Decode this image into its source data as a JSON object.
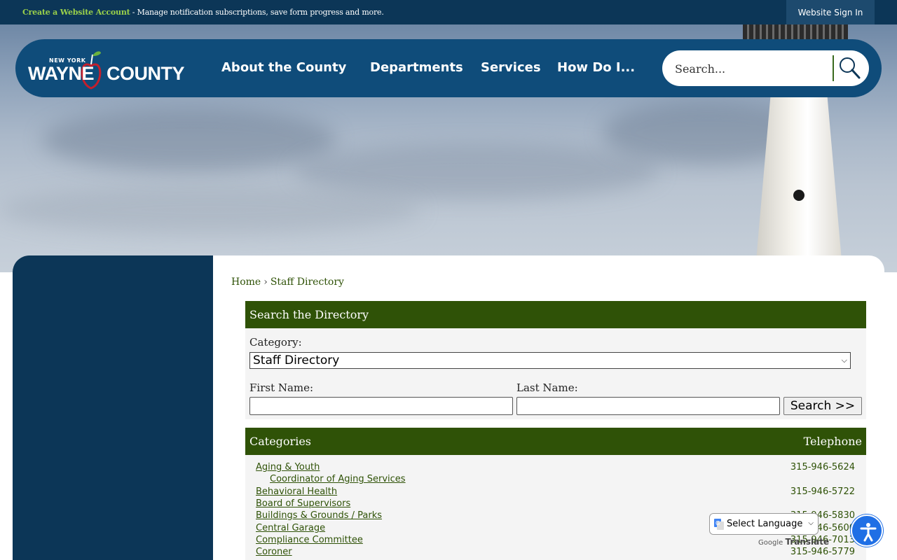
{
  "topbar": {
    "create_account": "Create a Website Account",
    "account_desc": " - Manage notification subscriptions, save form progress and more.",
    "sign_in": "Website Sign In"
  },
  "logo": {
    "state": "NEW YORK",
    "wayne": "WAYNE",
    "county": "COUNTY"
  },
  "nav": {
    "items": [
      {
        "label": "About the County"
      },
      {
        "label": "Departments"
      },
      {
        "label": "Services"
      },
      {
        "label": "How Do I..."
      }
    ],
    "search_placeholder": "Search...",
    "search_icon": "magnifier-icon"
  },
  "breadcrumb": {
    "home": "Home",
    "sep": "›",
    "current": "Staff Directory"
  },
  "search_section": {
    "title": "Search the Directory",
    "category_label": "Category:",
    "category_value": "Staff Directory",
    "first_name_label": "First Name:",
    "last_name_label": "Last Name:",
    "first_name_value": "",
    "last_name_value": "",
    "search_button": "Search >>"
  },
  "list_section": {
    "title": "Categories",
    "phone_header": "Telephone",
    "rows": [
      {
        "name": "Aging & Youth",
        "phone": "315-946-5624",
        "sub": false
      },
      {
        "name": "Coordinator of Aging Services",
        "phone": "",
        "sub": true
      },
      {
        "name": "Behavioral Health",
        "phone": "315-946-5722",
        "sub": false
      },
      {
        "name": "Board of Supervisors",
        "phone": "",
        "sub": false
      },
      {
        "name": "Buildings & Grounds / Parks",
        "phone": "315-946-5830",
        "sub": false
      },
      {
        "name": "Central Garage",
        "phone": "315-946-5600",
        "sub": false
      },
      {
        "name": "Compliance Committee",
        "phone": "315-946-7013",
        "sub": false
      },
      {
        "name": "Coroner",
        "phone": "315-946-5779",
        "sub": false
      }
    ]
  },
  "translate": {
    "select_label": "Select Language",
    "powered_by": "Google",
    "translate": "Translate"
  },
  "colors": {
    "navy": "#0c3657",
    "nav_blue": "#0f4c7a",
    "green": "#2f5207",
    "accent_green": "#9ad04a"
  }
}
